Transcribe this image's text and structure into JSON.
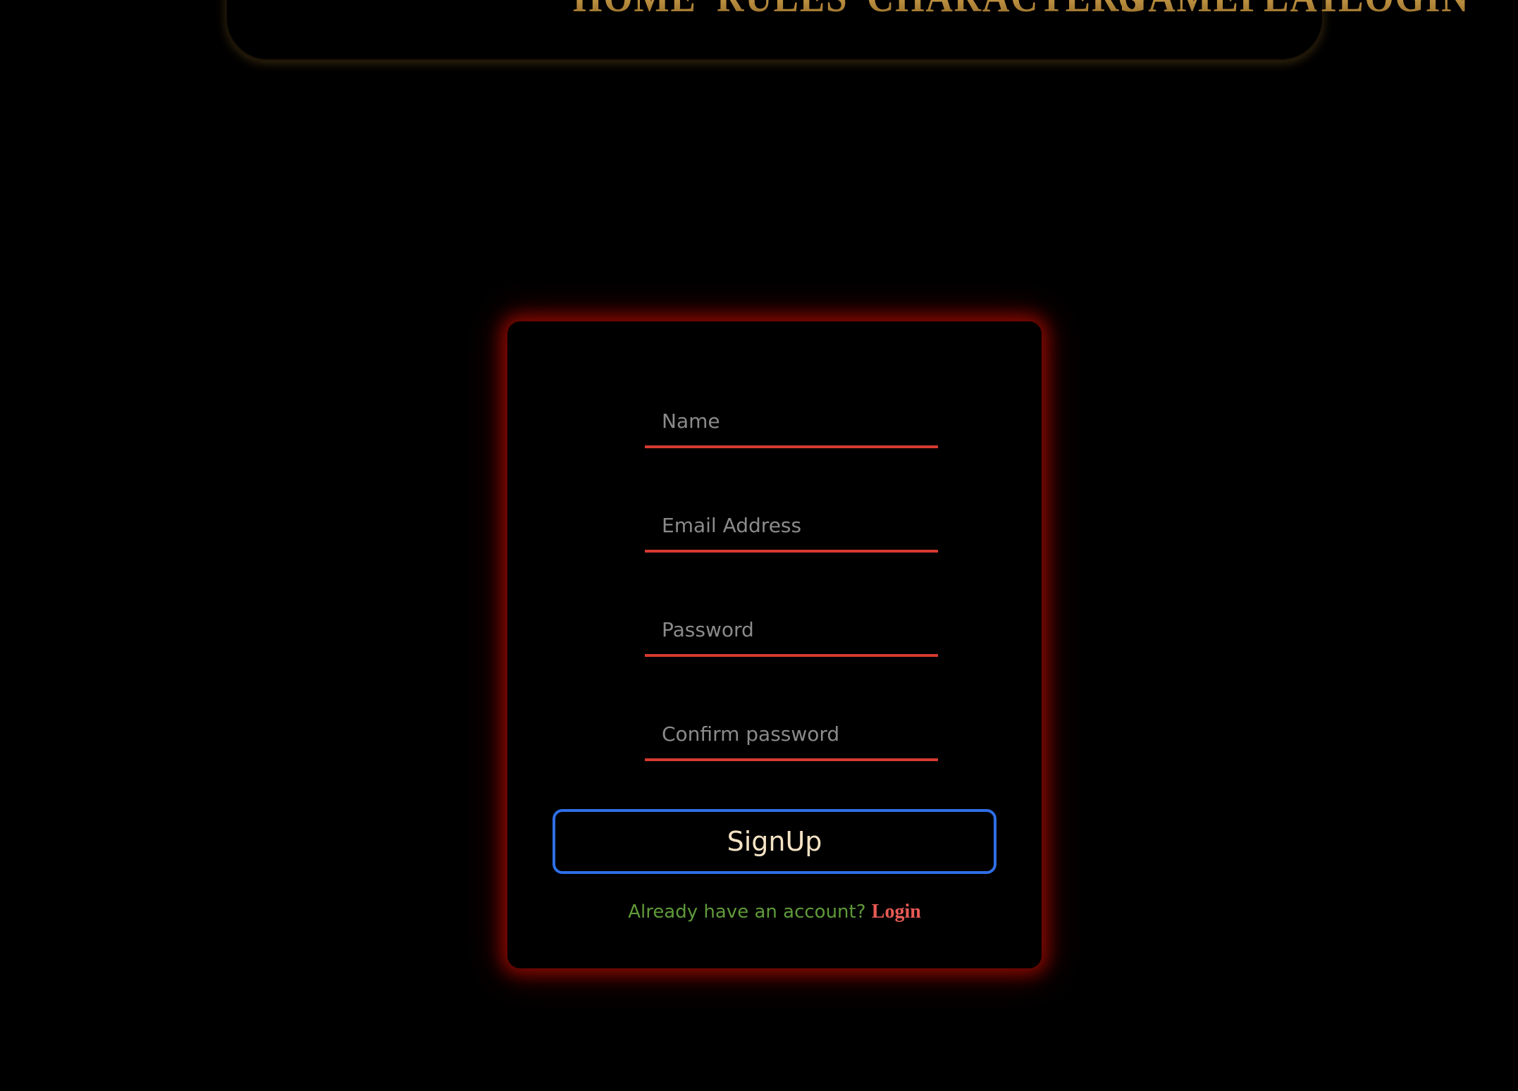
{
  "nav": {
    "items": [
      {
        "label": "HOME"
      },
      {
        "label": "RULES"
      },
      {
        "label": "CHARACTERS"
      },
      {
        "label": "GAMEPLAY"
      },
      {
        "label": "LOGIN"
      }
    ]
  },
  "form": {
    "name": {
      "value": "",
      "placeholder": "Name"
    },
    "email": {
      "value": "",
      "placeholder": "Email Address"
    },
    "password": {
      "value": "",
      "placeholder": "Password"
    },
    "confirm_password": {
      "value": "",
      "placeholder": "Confirm password"
    },
    "submit_label": "SignUp",
    "account_prompt": "Already have an account?",
    "login_link_label": "Login"
  },
  "colors": {
    "background": "#000000",
    "nav_gold": "#c89a48",
    "card_glow": "#aa0c00",
    "field_underline": "#d63a2f",
    "button_border": "#2f6fe6",
    "button_text": "#f4e2c4",
    "prompt_text": "#5f9a3a",
    "login_link": "#e85b55"
  }
}
